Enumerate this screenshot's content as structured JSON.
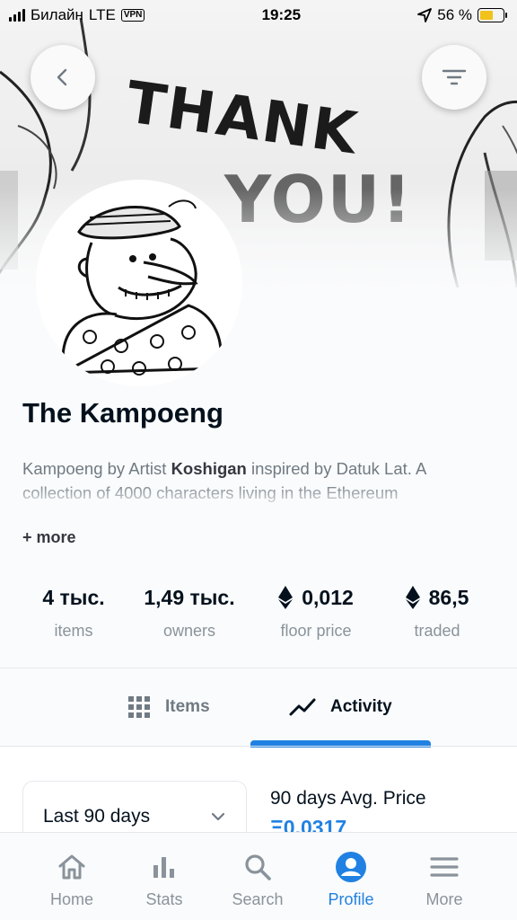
{
  "status_bar": {
    "carrier": "Билайн",
    "network": "LTE",
    "vpn": "VPN",
    "time": "19:25",
    "battery": "56 %"
  },
  "banner": {
    "line1": "THANK",
    "line2": "YOU!"
  },
  "collection": {
    "title": "The Kampoeng",
    "description_prefix": "Kampoeng by Artist ",
    "artist": "Koshigan",
    "description_rest": " inspired by Datuk Lat. A collection of 4000 characters living in the Ethereum",
    "more_label": "+ more"
  },
  "stats": [
    {
      "value": "4 тыс.",
      "label": "items",
      "eth": false
    },
    {
      "value": "1,49 тыс.",
      "label": "owners",
      "eth": false
    },
    {
      "value": "0,012",
      "label": "floor price",
      "eth": true
    },
    {
      "value": "86,5",
      "label": "traded",
      "eth": true
    }
  ],
  "tabs": {
    "items": "Items",
    "activity": "Activity",
    "active": "activity"
  },
  "activity": {
    "period_select": "Last 90 days",
    "avg_price_label": "90 days Avg. Price",
    "avg_price_value": "Ξ0,0317"
  },
  "nav": [
    {
      "label": "Home",
      "icon": "home-icon"
    },
    {
      "label": "Stats",
      "icon": "stats-icon"
    },
    {
      "label": "Search",
      "icon": "search-icon"
    },
    {
      "label": "Profile",
      "icon": "profile-icon"
    },
    {
      "label": "More",
      "icon": "menu-icon"
    }
  ],
  "colors": {
    "accent": "#2081e2",
    "text": "#04111d",
    "muted": "#8a939b"
  }
}
